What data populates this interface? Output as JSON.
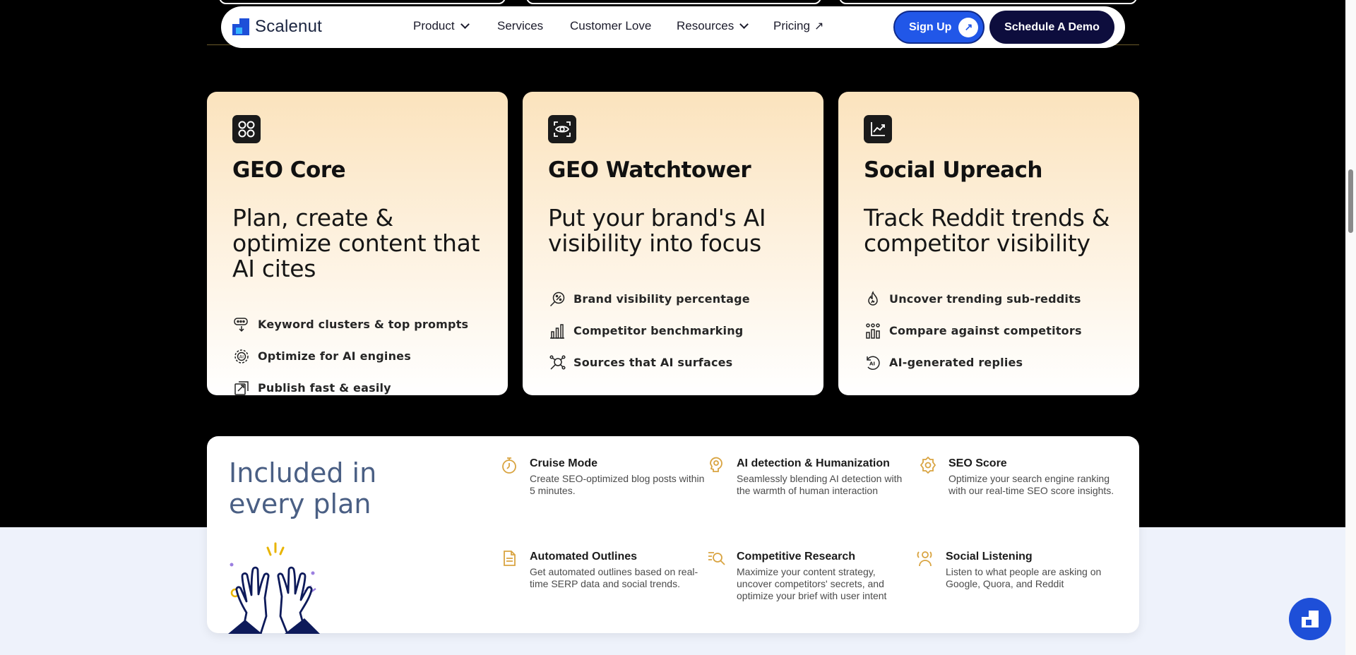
{
  "nav": {
    "logo_text": "Scalenut",
    "items": [
      {
        "label": "Product",
        "has_chevron": true
      },
      {
        "label": "Services"
      },
      {
        "label": "Customer Love"
      },
      {
        "label": "Resources",
        "has_chevron": true
      },
      {
        "label": "Pricing",
        "external": true
      }
    ],
    "external_glyph": "↗",
    "signup_label": "Sign Up",
    "signup_glyph": "↗",
    "demo_label": "Schedule A Demo"
  },
  "cards": [
    {
      "icon": "grid-icon",
      "title": "GEO Core",
      "subtitle": "Plan, create & optimize content that AI cites",
      "features": [
        {
          "icon": "keyword-cluster-icon",
          "label": "Keyword clusters & top prompts"
        },
        {
          "icon": "ai-gear-icon",
          "label": "Optimize for AI engines"
        },
        {
          "icon": "publish-icon",
          "label": "Publish fast & easily"
        }
      ]
    },
    {
      "icon": "eye-icon",
      "title": "GEO Watchtower",
      "subtitle": "Put your brand's AI visibility into focus",
      "features": [
        {
          "icon": "percentage-icon",
          "label": "Brand visibility percentage"
        },
        {
          "icon": "bar-chart-icon",
          "label": "Competitor benchmarking"
        },
        {
          "icon": "sources-icon",
          "label": "Sources that AI surfaces"
        }
      ]
    },
    {
      "icon": "trend-chart-icon",
      "title": "Social Upreach",
      "subtitle": "Track Reddit trends & competitor visibility",
      "features": [
        {
          "icon": "fire-icon",
          "label": "Uncover trending sub-reddits"
        },
        {
          "icon": "compare-icon",
          "label": "Compare against competitors"
        },
        {
          "icon": "ai-reply-icon",
          "label": "AI-generated replies"
        }
      ]
    }
  ],
  "included": {
    "title": "Included in every plan",
    "items": [
      {
        "icon": "timer-icon",
        "title": "Cruise Mode",
        "desc": "Create SEO-optimized blog posts within 5 minutes."
      },
      {
        "icon": "ai-detection-icon",
        "title": "AI detection & Humanization",
        "desc": "Seamlessly blending AI detection with the warmth of human interaction"
      },
      {
        "icon": "seo-score-icon",
        "title": "SEO Score",
        "desc": "Optimize your search engine ranking with our real-time SEO score insights."
      },
      {
        "icon": "document-icon",
        "title": "Automated Outlines",
        "desc": "Get automated outlines based on real-time SERP data and social trends."
      },
      {
        "icon": "research-icon",
        "title": "Competitive Research",
        "desc": "Maximize your content strategy, uncover competitors' secrets, and optimize your brief with user intent"
      },
      {
        "icon": "listening-icon",
        "title": "Social Listening",
        "desc": "Listen to what people are asking on Google, Quora, and Reddit"
      }
    ]
  },
  "colors": {
    "accent_blue": "#2157e8",
    "navy": "#0d0d3d",
    "card_peach": "#fbe3bd",
    "included_title": "#4a5f84",
    "icon_gold": "#d9a441"
  }
}
